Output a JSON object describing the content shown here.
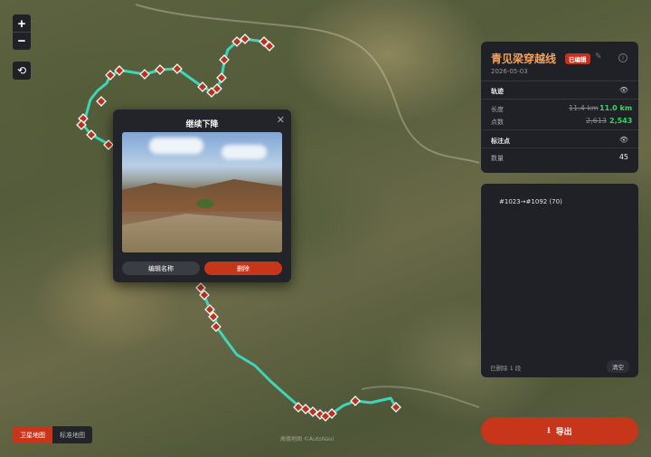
{
  "map": {
    "zoom_in": "+",
    "zoom_out": "−",
    "reset_icon": "⟲",
    "attribution": "高德地图 ©AutoNavi"
  },
  "popup": {
    "title": "继续下降",
    "close": "✕",
    "rename_label": "编辑名称",
    "delete_label": "删除"
  },
  "route": {
    "title": "青见梁穿越线",
    "badge": "已编辑",
    "date": "2026-05-03",
    "track_section": "轨迹",
    "length_label": "长度",
    "length_old": "11.4 km",
    "length_new": "11.0 km",
    "points_label": "点数",
    "points_old": "2,613",
    "points_new": "2,543",
    "markers_section": "标注点",
    "count_label": "数量",
    "count_value": "45"
  },
  "log": {
    "entry": "#1023→#1092 (70)",
    "footer": "已删除 1 段",
    "clear_label": "清空"
  },
  "export": {
    "label": "导出",
    "icon": "⭳"
  },
  "layers": {
    "satellite": "卫星地图",
    "standard": "标准地图"
  },
  "colors": {
    "accent": "#c7361a",
    "track": "#3fd6b8",
    "title": "#f3a25c",
    "success": "#39d36a"
  }
}
